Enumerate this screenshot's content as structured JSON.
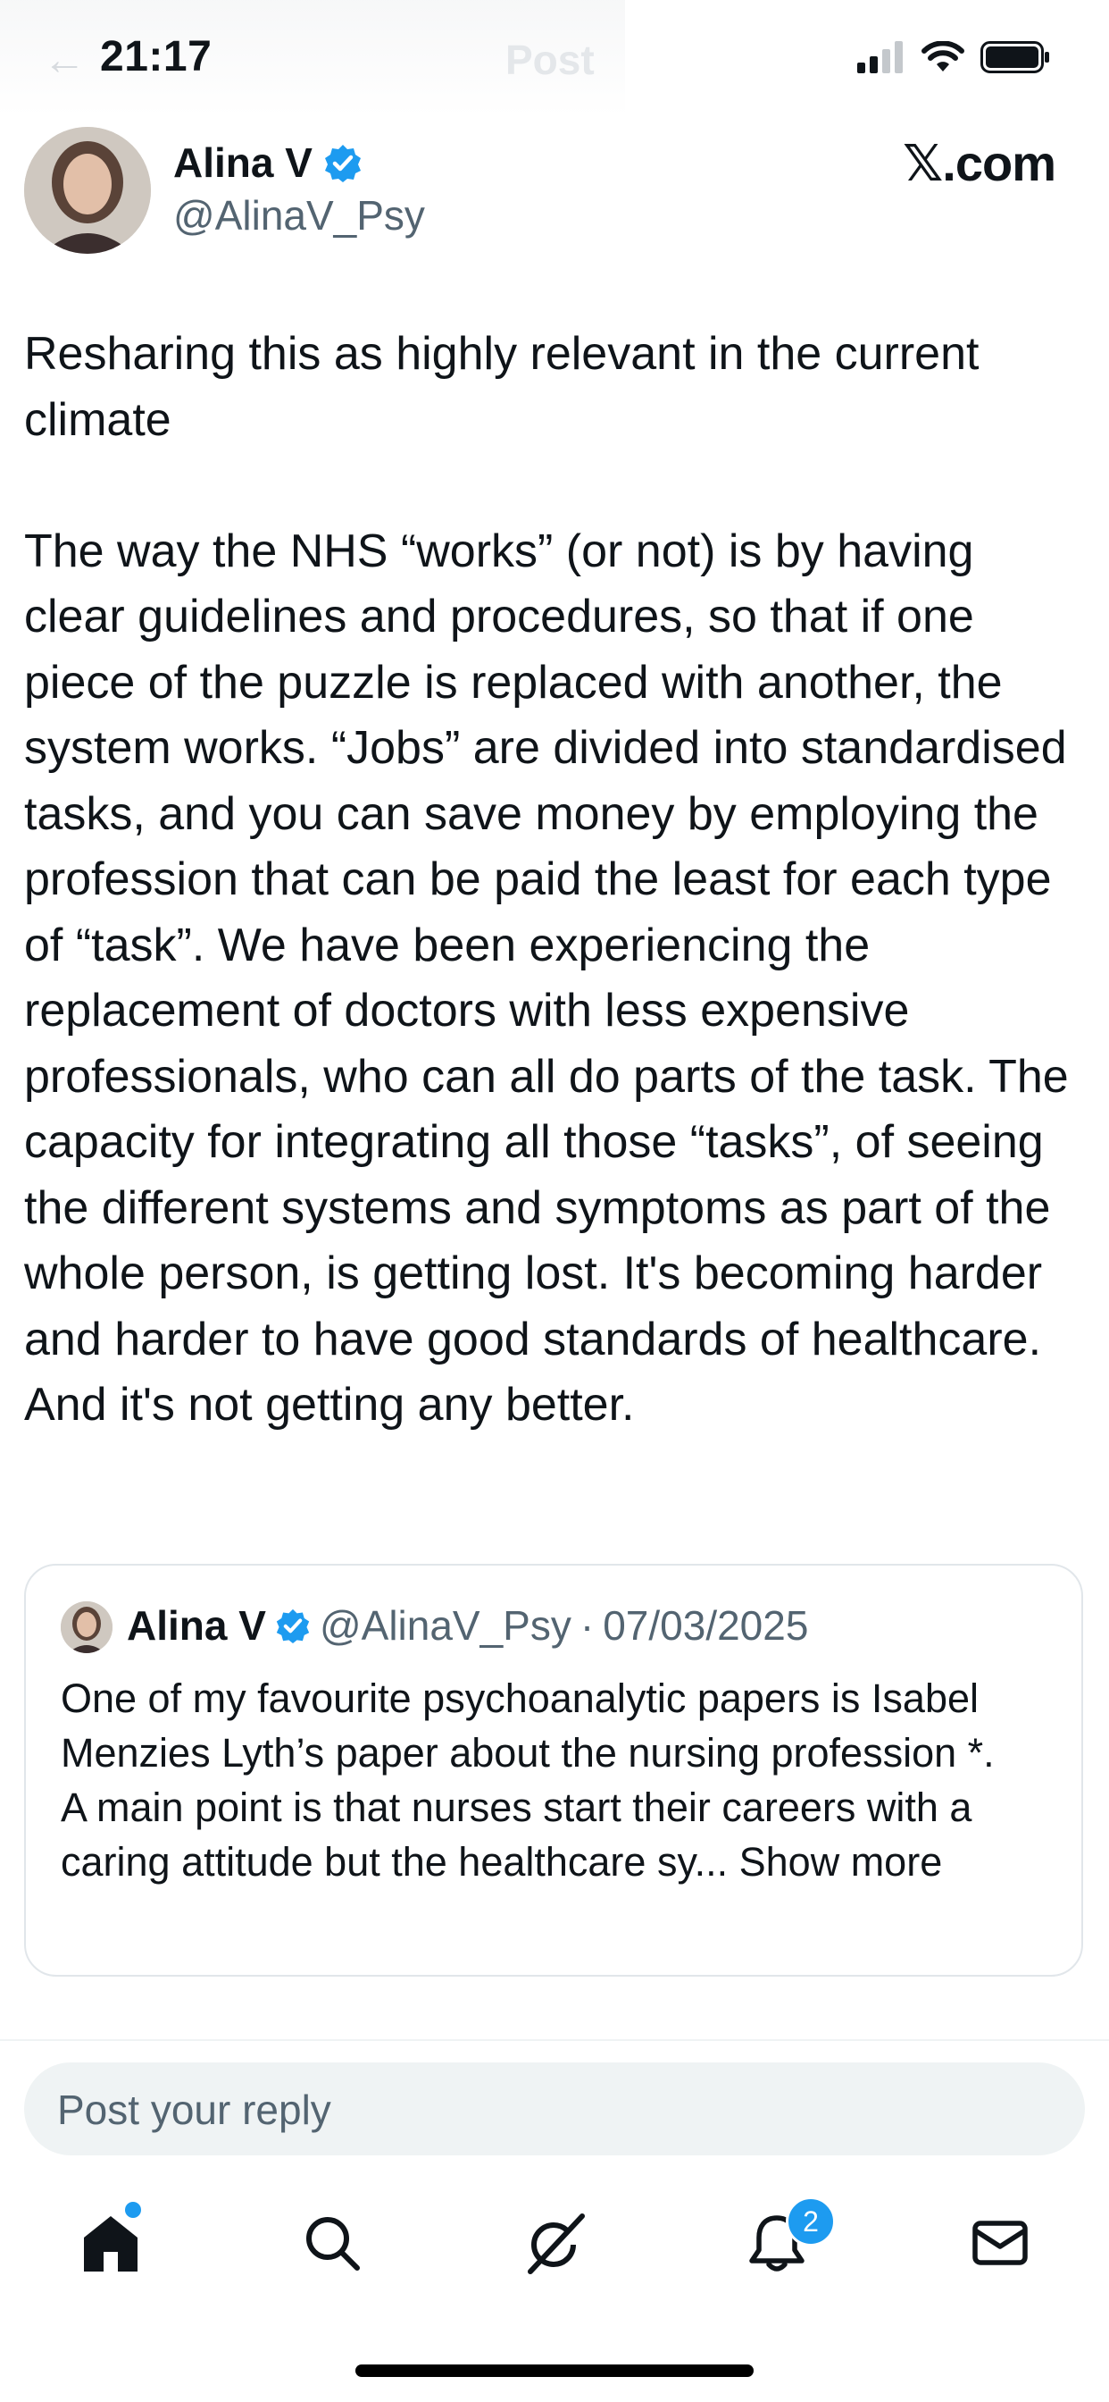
{
  "status_bar": {
    "time": "21:17"
  },
  "header": {
    "faded_title": "Post",
    "site_mark": "𝕏.com"
  },
  "author": {
    "name": "Alina V",
    "handle": "@AlinaV_Psy",
    "verified": true
  },
  "post": {
    "text": "Resharing this as highly relevant in the current climate\n\nThe way the NHS “works” (or not) is by having clear guidelines and procedures, so that if one piece of the puzzle is replaced with another, the system works. “Jobs” are divided into standardised tasks, and you can save money by employing the profession that can be paid the least for each type of “task”. We have been experiencing the replacement of doctors with less expensive professionals, who can all do parts of the task. The capacity for integrating all those “tasks”, of seeing the different systems and symptoms as part of the whole person, is getting lost. It's becoming harder and harder to have good standards of healthcare.\nAnd it's not getting any better."
  },
  "quoted_post": {
    "name": "Alina V",
    "handle": "@AlinaV_Psy",
    "separator": "·",
    "date": "07/03/2025",
    "text": "One of my favourite psychoanalytic papers is Isabel Menzies Lyth’s paper about the nursing profession *.\nA main point is that nurses start their careers with a caring attitude but the healthcare sy...",
    "show_more": " Show more"
  },
  "reply": {
    "placeholder": "Post your reply"
  },
  "tabbar": {
    "notifications_badge": "2",
    "accent_color": "#1d9bf0"
  }
}
